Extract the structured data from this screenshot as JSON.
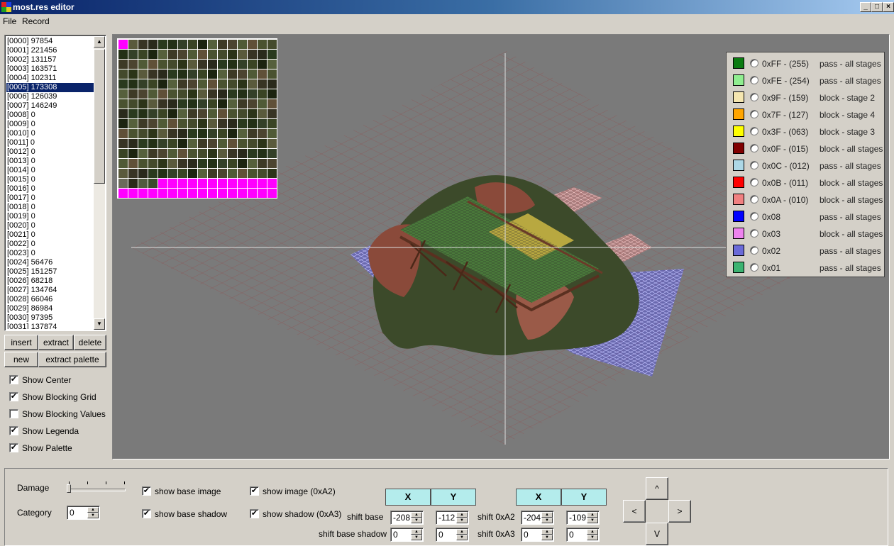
{
  "window": {
    "title": "most.res editor",
    "min_icon": "_",
    "max_icon": "□",
    "close_icon": "×"
  },
  "menu": {
    "items": [
      "File",
      "Record"
    ]
  },
  "list": {
    "items": [
      "[0000] 97854",
      "[0001] 221456",
      "[0002] 131157",
      "[0003] 163571",
      "[0004] 102311",
      "[0005] 173308",
      "[0006] 126039",
      "[0007] 146249",
      "[0008] 0",
      "[0009] 0",
      "[0010] 0",
      "[0011] 0",
      "[0012] 0",
      "[0013] 0",
      "[0014] 0",
      "[0015] 0",
      "[0016] 0",
      "[0017] 0",
      "[0018] 0",
      "[0019] 0",
      "[0020] 0",
      "[0021] 0",
      "[0022] 0",
      "[0023] 0",
      "[0024] 56476",
      "[0025] 151257",
      "[0026] 68218",
      "[0027] 134764",
      "[0028] 66046",
      "[0029] 86984",
      "[0030] 97395",
      "[0031] 137874"
    ],
    "selected_index": 5
  },
  "buttons": {
    "insert": "insert",
    "extract": "extract",
    "delete": "delete",
    "new": "new",
    "extract_palette": "extract palette"
  },
  "options": {
    "show_center": {
      "label": "Show Center",
      "checked": true
    },
    "show_blocking_grid": {
      "label": "Show Blocking Grid",
      "checked": true
    },
    "show_blocking_values": {
      "label": "Show Blocking Values",
      "checked": false
    },
    "show_legenda": {
      "label": "Show Legenda",
      "checked": true
    },
    "show_palette": {
      "label": "Show Palette",
      "checked": true
    }
  },
  "legend": [
    {
      "color": "#0a7a10",
      "code": "0xFF - (255)",
      "desc": "pass - all stages"
    },
    {
      "color": "#90ee90",
      "code": "0xFE - (254)",
      "desc": "pass - all stages"
    },
    {
      "color": "#f5e6b0",
      "code": "0x9F - (159)",
      "desc": "block - stage 2"
    },
    {
      "color": "#ffa500",
      "code": "0x7F - (127)",
      "desc": "block - stage 4"
    },
    {
      "color": "#ffff00",
      "code": "0x3F - (063)",
      "desc": "block - stage 3"
    },
    {
      "color": "#800000",
      "code": "0x0F - (015)",
      "desc": "block - all stages"
    },
    {
      "color": "#add8e6",
      "code": "0x0C - (012)",
      "desc": "pass - all stages"
    },
    {
      "color": "#ff0000",
      "code": "0x0B - (011)",
      "desc": "block - all stages"
    },
    {
      "color": "#f08080",
      "code": "0x0A - (010)",
      "desc": "block - all stages"
    },
    {
      "color": "#0000ff",
      "code": "0x08",
      "desc": "pass - all stages"
    },
    {
      "color": "#ee82ee",
      "code": "0x03",
      "desc": "block - all stages"
    },
    {
      "color": "#6a6ad8",
      "code": "0x02",
      "desc": "pass - all stages"
    },
    {
      "color": "#3cb371",
      "code": "0x01",
      "desc": "pass - all stages"
    }
  ],
  "bottom": {
    "damage_label": "Damage",
    "category_label": "Category",
    "category_value": "0",
    "show_base_image": {
      "label": "show base image",
      "checked": true
    },
    "show_base_shadow": {
      "label": "show base shadow",
      "checked": true
    },
    "show_image_a2": {
      "label": "show image (0xA2)",
      "checked": true
    },
    "show_shadow_a3": {
      "label": "show shadow (0xA3)",
      "checked": true
    },
    "x_header": "X",
    "y_header": "Y",
    "shift_base_label": "shift base",
    "shift_base_shadow_label": "shift base shadow",
    "shift_a2_label": "shift 0xA2",
    "shift_a3_label": "shift 0xA3",
    "shift_base": {
      "x": "-208",
      "y": "-112"
    },
    "shift_base_shadow": {
      "x": "0",
      "y": "0"
    },
    "shift_a2": {
      "x": "-204",
      "y": "-109"
    },
    "shift_a3": {
      "x": "0",
      "y": "0"
    },
    "nav": {
      "up": "^",
      "left": "<",
      "right": ">",
      "down": "V"
    }
  }
}
